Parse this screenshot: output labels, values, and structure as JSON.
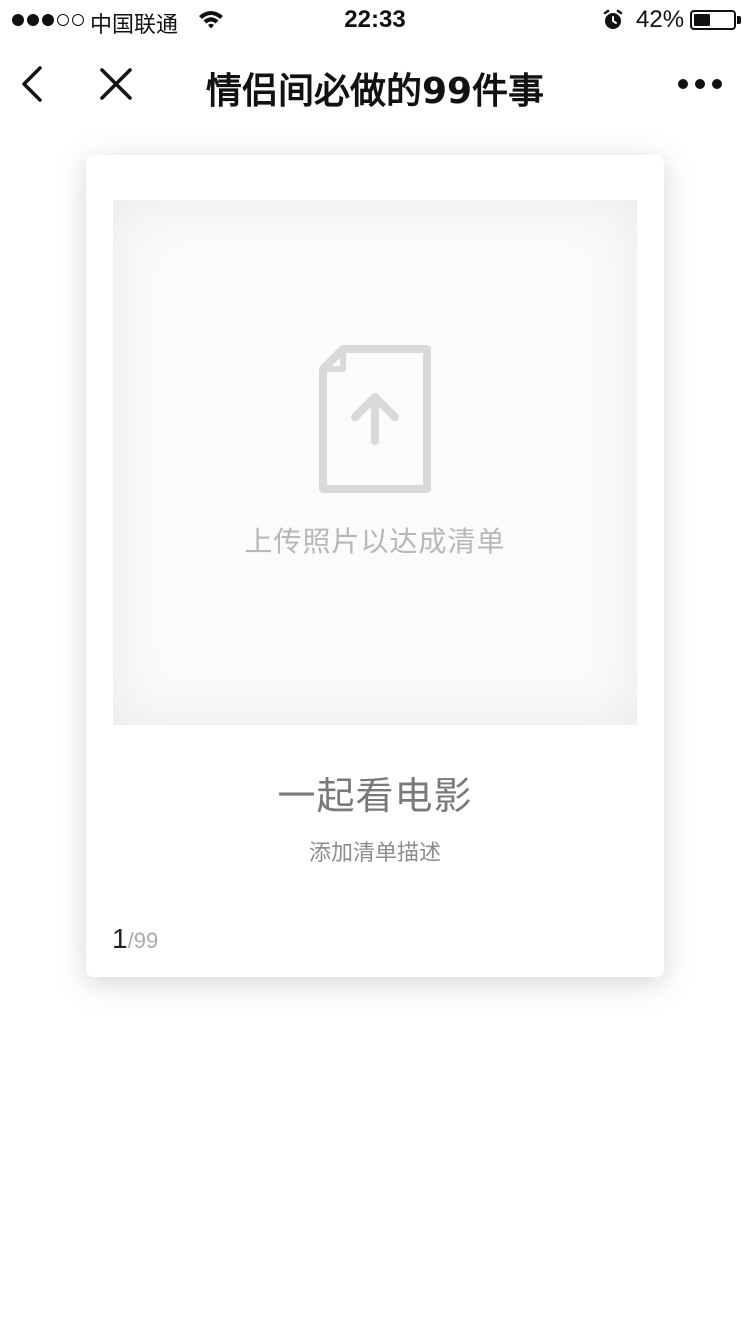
{
  "status_bar": {
    "carrier": "中国联通",
    "time": "22:33",
    "battery_percent": "42%",
    "battery_level": 0.42,
    "signal_bars": 3,
    "signal_max": 5,
    "icons": [
      "wifi-icon",
      "alarm-icon",
      "battery-icon"
    ]
  },
  "nav": {
    "title": "情侣间必做的99件事",
    "icons": [
      "chevron-left-icon",
      "close-icon",
      "more-icon"
    ]
  },
  "card": {
    "upload_prompt": "上传照片以达成清单",
    "upload_icon": "file-upload-icon",
    "item_title": "一起看电影",
    "item_description": "添加清单描述",
    "counter": {
      "current": "1",
      "separator": "/",
      "total": "99"
    }
  },
  "colors": {
    "background": "#ffffff",
    "text_primary": "#111111",
    "text_muted": "#b7b7b7",
    "icon_gray": "#d8d8d8"
  }
}
